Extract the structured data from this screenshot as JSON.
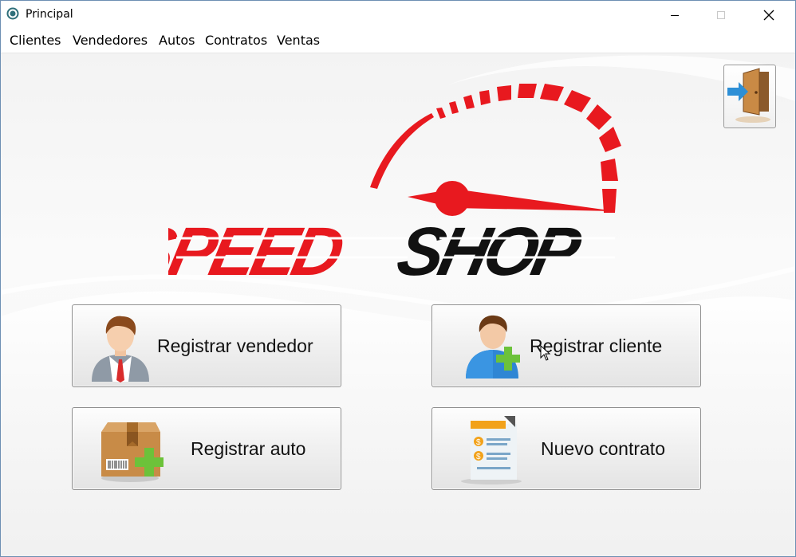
{
  "window": {
    "title": "Principal"
  },
  "menu": {
    "items": [
      {
        "label": "Clientes"
      },
      {
        "label": "Vendedores"
      },
      {
        "label": "Autos"
      },
      {
        "label": "Contratos"
      },
      {
        "label": "Ventas"
      }
    ]
  },
  "logo": {
    "word1": "SPEED",
    "word2": "SHOP",
    "brand_red": "#e8191f",
    "brand_black": "#111111"
  },
  "buttons": {
    "registrar_vendedor": "Registrar vendedor",
    "registrar_cliente": "Registrar cliente",
    "registrar_auto": "Registrar auto",
    "nuevo_contrato": "Nuevo contrato"
  },
  "icons": {
    "exit": "door-exit-icon",
    "vendedor": "businessman-icon",
    "cliente": "user-add-icon",
    "auto": "box-add-icon",
    "contrato": "document-icon"
  }
}
